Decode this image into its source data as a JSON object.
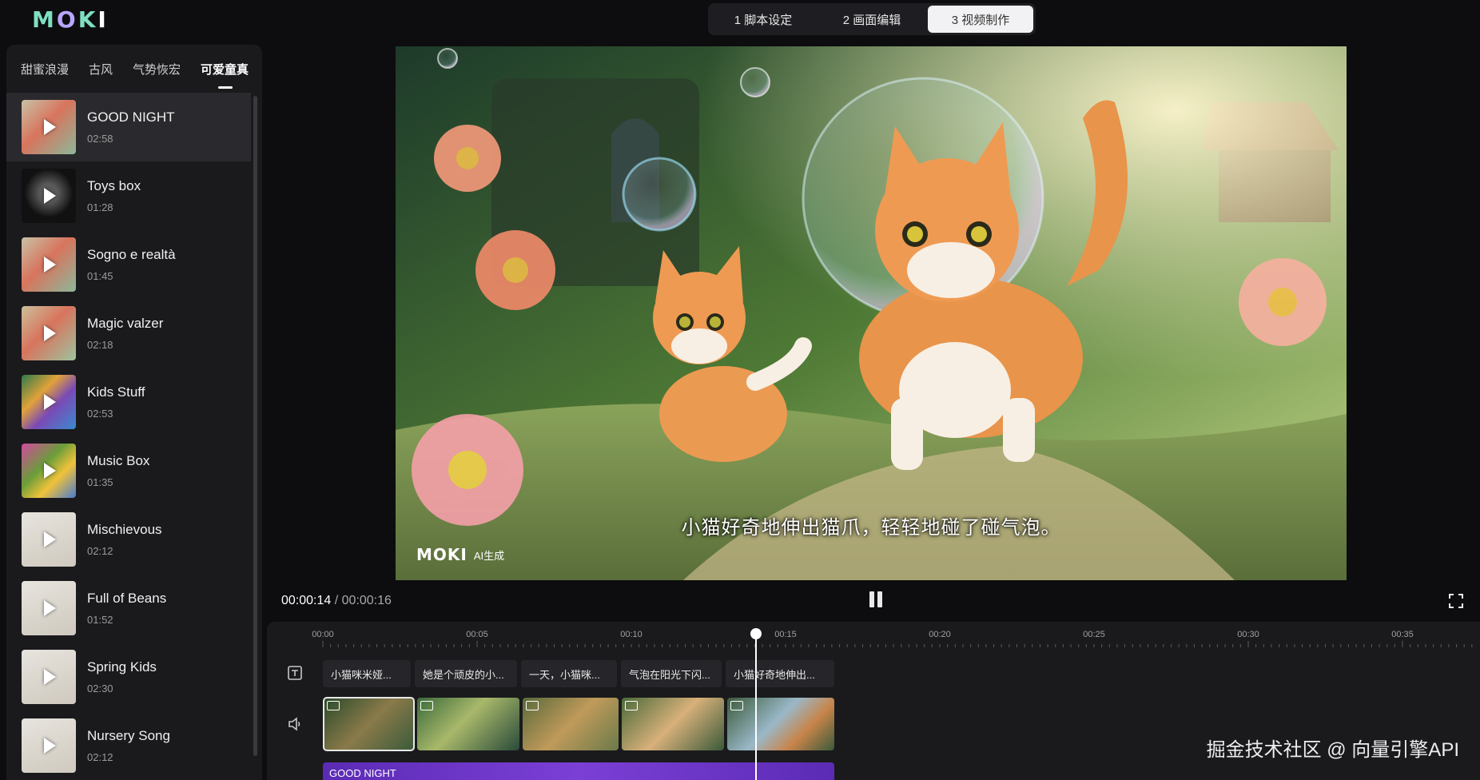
{
  "brand": {
    "logo": "MOKI"
  },
  "steps": [
    {
      "label": "1 脚本设定",
      "active": false
    },
    {
      "label": "2 画面编辑",
      "active": false
    },
    {
      "label": "3 视频制作",
      "active": true
    }
  ],
  "sidebar": {
    "categories": [
      "甜蜜浪漫",
      "古风",
      "气势恢宏",
      "可爱童真"
    ],
    "active_category": "可爱童真",
    "tracks": [
      {
        "title": "GOOD NIGHT",
        "duration": "02:58"
      },
      {
        "title": "Toys box",
        "duration": "01:28"
      },
      {
        "title": "Sogno e realtà",
        "duration": "01:45"
      },
      {
        "title": "Magic valzer",
        "duration": "02:18"
      },
      {
        "title": "Kids Stuff",
        "duration": "02:53"
      },
      {
        "title": "Music Box",
        "duration": "01:35"
      },
      {
        "title": "Mischievous",
        "duration": "02:12"
      },
      {
        "title": "Full of Beans",
        "duration": "01:52"
      },
      {
        "title": "Spring Kids",
        "duration": "02:30"
      },
      {
        "title": "Nursery Song",
        "duration": "02:12"
      }
    ]
  },
  "preview": {
    "subtitle": "小猫好奇地伸出猫爪，轻轻地碰了碰气泡。",
    "watermark_logo": "MOKI",
    "watermark_tag": "AI生成"
  },
  "player": {
    "current_time": "00:00:14",
    "separator": "/",
    "total_time": "00:00:16"
  },
  "timeline": {
    "ticks": [
      "00:00",
      "00:05",
      "00:10",
      "00:15",
      "00:20",
      "00:25",
      "00:30",
      "00:35"
    ],
    "captions": [
      "小猫咪米娅...",
      "她是个顽皮的小...",
      "一天，小猫咪...",
      "气泡在阳光下闪...",
      "小猫好奇地伸出..."
    ],
    "audio_track": "GOOD NIGHT"
  },
  "overlay_watermark": "掘金技术社区 @ 向量引擎API",
  "colors": {
    "accent": "#7b3fd6",
    "background": "#0d0d0f",
    "panel": "#1a1a1d"
  }
}
